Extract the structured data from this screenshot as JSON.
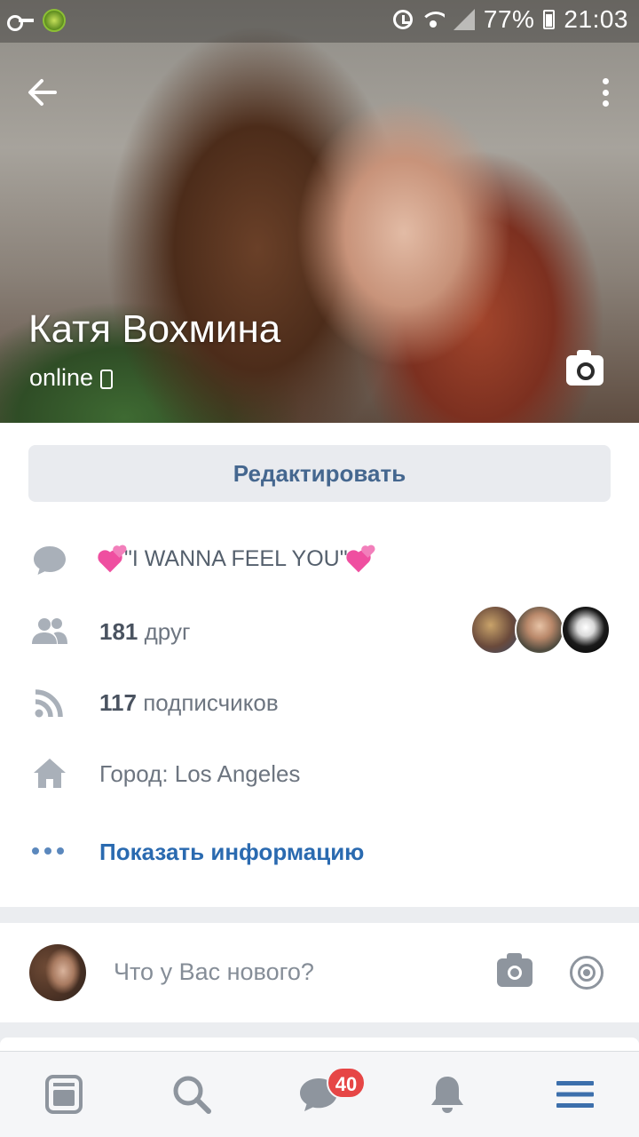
{
  "status_bar": {
    "battery": "77%",
    "time": "21:03"
  },
  "header": {
    "back_icon": "arrow-left-icon",
    "more_icon": "more-vertical-icon"
  },
  "profile": {
    "name": "Катя Вохмина",
    "status": "online",
    "edit_label": "Редактировать",
    "status_message": "\"I WANNA FEEL YOU\"",
    "friends_count": "181",
    "friends_label": "друг",
    "followers_count": "117",
    "followers_label": "подписчиков",
    "city": "Город: Los Angeles",
    "show_info_label": "Показать информацию"
  },
  "composer": {
    "placeholder": "Что у Вас нового?"
  },
  "bottom_nav": {
    "items": [
      "news-icon",
      "search-icon",
      "messages-icon",
      "notifications-icon",
      "menu-icon"
    ],
    "messages_badge": "40"
  },
  "colors": {
    "accent": "#2a6ab0",
    "edit_text": "#45678f",
    "badge": "#e64646",
    "icon_gray": "#8e959e"
  }
}
